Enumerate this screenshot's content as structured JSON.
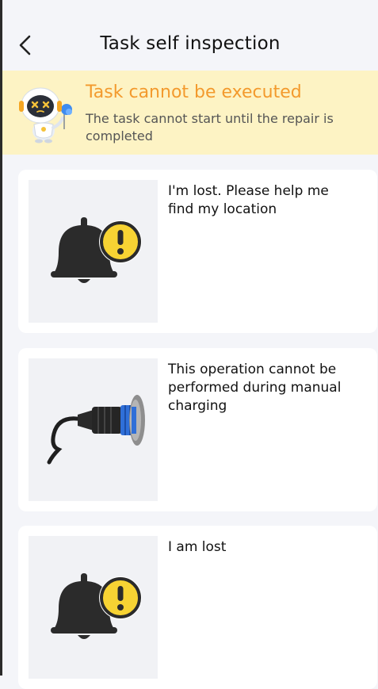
{
  "header": {
    "title": "Task self inspection",
    "back_icon": "chevron-left-icon"
  },
  "banner": {
    "title": "Task cannot be executed",
    "subtitle": "The task cannot start until the repair is completed",
    "icon": "robot-error-icon",
    "title_color": "#f39a2d",
    "background": "#fdf3c4"
  },
  "cards": [
    {
      "text": "I'm lost. Please help me find my location",
      "icon": "bell-warning-icon"
    },
    {
      "text": "This operation cannot be performed during manual charging",
      "icon": "charging-plug-icon"
    },
    {
      "text": "I am lost",
      "icon": "bell-warning-icon"
    }
  ]
}
